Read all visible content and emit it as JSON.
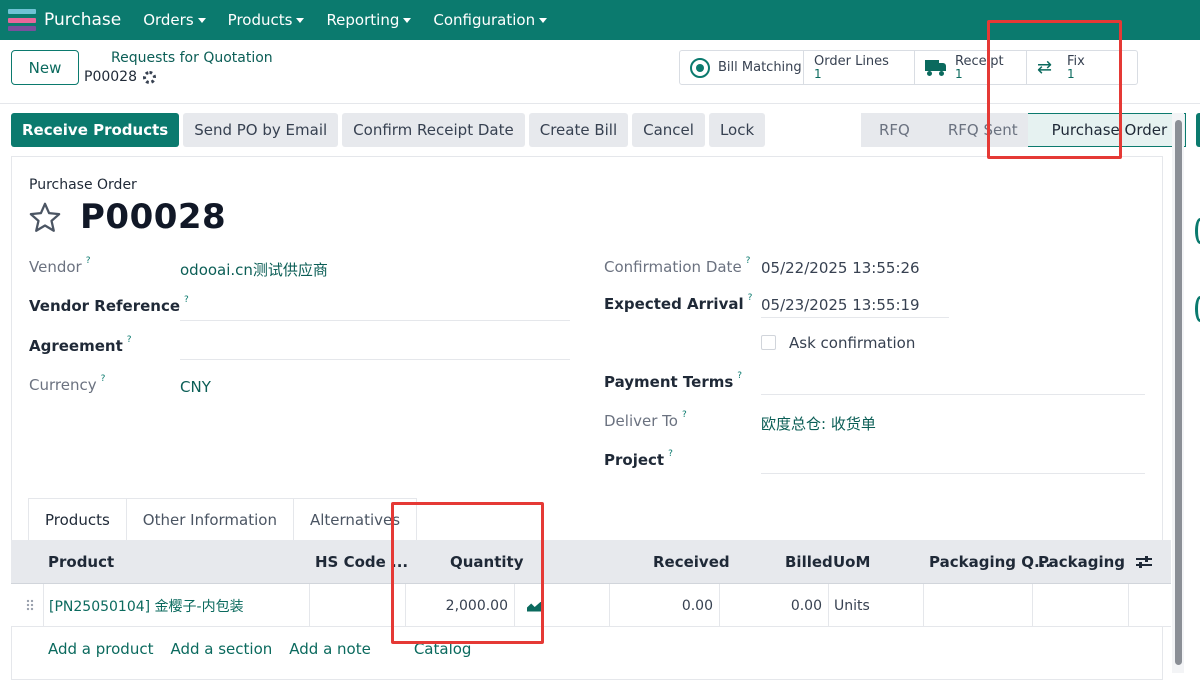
{
  "app": {
    "name": "Purchase",
    "icon_colors": [
      "#6fc3d5",
      "#e8669a",
      "#7a4f9c"
    ],
    "menu": [
      {
        "label": "Orders"
      },
      {
        "label": "Products"
      },
      {
        "label": "Reporting"
      },
      {
        "label": "Configuration"
      }
    ]
  },
  "control": {
    "new_label": "New",
    "breadcrumb_parent": "Requests for Quotation",
    "breadcrumb_current": "P00028"
  },
  "smart_buttons": {
    "bill_matching": {
      "label": "Bill Matching"
    },
    "order_lines": {
      "label": "Order Lines",
      "value": "1"
    },
    "receipt": {
      "label": "Receipt",
      "value": "1"
    },
    "fix": {
      "label": "Fix",
      "value": "1"
    }
  },
  "actions": [
    {
      "label": "Receive Products"
    },
    {
      "label": "Send PO by Email"
    },
    {
      "label": "Confirm Receipt Date"
    },
    {
      "label": "Create Bill"
    },
    {
      "label": "Cancel"
    },
    {
      "label": "Lock"
    }
  ],
  "status": [
    {
      "label": "RFQ"
    },
    {
      "label": "RFQ Sent"
    },
    {
      "label": "Purchase Order"
    }
  ],
  "form": {
    "title_label": "Purchase Order",
    "name": "P00028",
    "vendor": {
      "label": "Vendor",
      "value": "odooai.cn测试供应商"
    },
    "vendor_reference": {
      "label": "Vendor Reference",
      "value": ""
    },
    "agreement": {
      "label": "Agreement",
      "value": ""
    },
    "currency": {
      "label": "Currency",
      "value": "CNY"
    },
    "confirmation_date": {
      "label": "Confirmation Date",
      "value": "05/22/2025 13:55:26"
    },
    "expected_arrival": {
      "label": "Expected Arrival",
      "value": "05/23/2025 13:55:19"
    },
    "ask_confirmation": {
      "label": "Ask confirmation",
      "checked": false
    },
    "payment_terms": {
      "label": "Payment Terms",
      "value": ""
    },
    "deliver_to": {
      "label": "Deliver To",
      "value": "欧度总仓: 收货单"
    },
    "project": {
      "label": "Project",
      "value": ""
    },
    "help_mark": "?"
  },
  "tabs": [
    {
      "label": "Products"
    },
    {
      "label": "Other Information"
    },
    {
      "label": "Alternatives"
    }
  ],
  "table": {
    "columns": {
      "product": "Product",
      "hs_code": "HS Code ...",
      "quantity": "Quantity",
      "received": "Received",
      "billed": "Billed",
      "uom": "UoM",
      "packaging_qty": "Packaging Q...",
      "packaging": "Packaging"
    },
    "rows": [
      {
        "product": "[PN25050104] 金樱子-内包装",
        "hs_code": "",
        "quantity": "2,000.00",
        "received": "0.00",
        "billed": "0.00",
        "uom": "Units",
        "packaging_qty": "",
        "packaging": ""
      }
    ],
    "add_links": {
      "product": "Add a product",
      "section": "Add a section",
      "note": "Add a note",
      "catalog": "Catalog"
    }
  },
  "colors": {
    "brand": "#0b7a6e",
    "highlight": "#e53935"
  }
}
